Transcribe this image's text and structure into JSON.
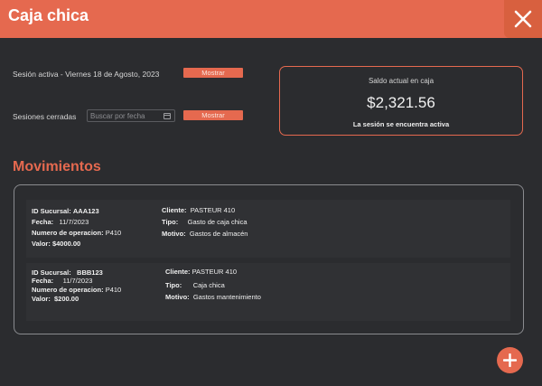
{
  "header": {
    "title": "Caja chica",
    "close_icon": "close-icon"
  },
  "session": {
    "active_label": "Sesión activa - Viernes 18 de Agosto, 2023",
    "active_button": "Mostrar",
    "closed_label": "Sesiones cerradas",
    "search_placeholder": "Buscar por fecha",
    "closed_button": "Mostrar"
  },
  "balance": {
    "label": "Saldo actual en caja",
    "amount": "$2,321.56",
    "status": "La sesión se encuentra activa"
  },
  "movements_title": "Movimientos",
  "movements": [
    {
      "branch_label": "ID Sucursal:",
      "branch": "AAA123",
      "date_label": "Fecha:",
      "date": "11/7/2023",
      "op_label": "Numero de operacion:",
      "op": "P410",
      "value_label": "Valor:",
      "value": "$4000.00",
      "client_label": "Cliente:",
      "client": "PASTEUR 410",
      "type_label": "Tipo:",
      "type": "Gasto de caja chica",
      "reason_label": "Motivo:",
      "reason": "Gastos de almacén"
    },
    {
      "branch_label": "ID Sucursal:",
      "branch": "BBB123",
      "date_label": "Fecha:",
      "date": "11/7/2023",
      "op_label": "Numero de operacion:",
      "op": "P410",
      "value_label": "Valor:",
      "value": "$200.00",
      "client_label": "Cliente:",
      "client": "PASTEUR 410",
      "type_label": "Tipo:",
      "type": "Caja chica",
      "reason_label": "Motivo:",
      "reason": "Gastos mantenimiento"
    }
  ],
  "colors": {
    "accent": "#e5694f",
    "background": "#2b2c2f"
  },
  "fab_icon": "plus-icon"
}
